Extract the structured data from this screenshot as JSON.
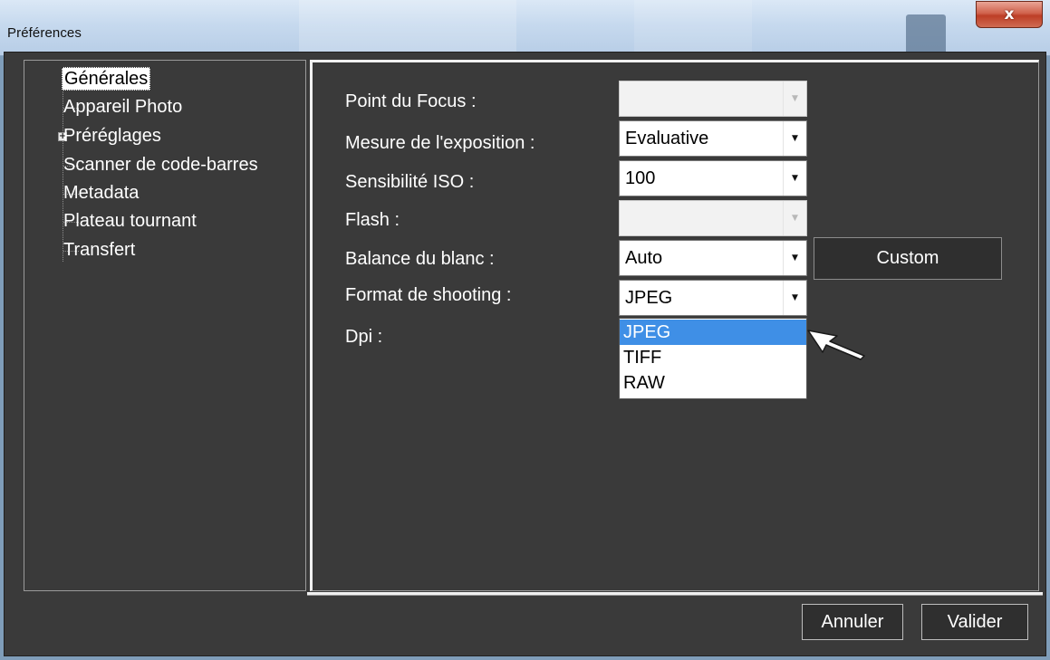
{
  "window": {
    "title": "Préférences",
    "close_glyph": "x"
  },
  "tree": {
    "items": [
      {
        "label": "Générales",
        "selected": true,
        "expandable": false
      },
      {
        "label": "Appareil Photo",
        "selected": false,
        "expandable": false
      },
      {
        "label": "Préréglages",
        "selected": false,
        "expandable": true
      },
      {
        "label": "Scanner de code-barres",
        "selected": false,
        "expandable": false
      },
      {
        "label": "Metadata",
        "selected": false,
        "expandable": false
      },
      {
        "label": "Plateau tournant",
        "selected": false,
        "expandable": false
      },
      {
        "label": "Transfert",
        "selected": false,
        "expandable": false
      }
    ],
    "expander_glyph": "+"
  },
  "form": {
    "focus_label": "Point  du  Focus :",
    "focus_value": "",
    "exposure_label": "Mesure de l'exposition :",
    "exposure_value": "Evaluative",
    "iso_label": "Sensibilité ISO :",
    "iso_value": "100",
    "flash_label": "Flash :",
    "flash_value": "",
    "wb_label": "Balance du blanc :",
    "wb_value": "Auto",
    "custom_label": "Custom",
    "format_label": "Format de shooting :",
    "format_value": "JPEG",
    "dpi_label": "Dpi :",
    "format_options": [
      "JPEG",
      "TIFF",
      "RAW"
    ],
    "format_highlighted": "JPEG"
  },
  "buttons": {
    "cancel": "Annuler",
    "ok": "Valider"
  },
  "colors": {
    "panel_bg": "#3a3a3a",
    "highlight": "#3f8fe6",
    "close_red": "#c8513a"
  },
  "icons": {
    "dropdown_arrow": "▼",
    "pointer": "arrow-pointer-icon"
  }
}
